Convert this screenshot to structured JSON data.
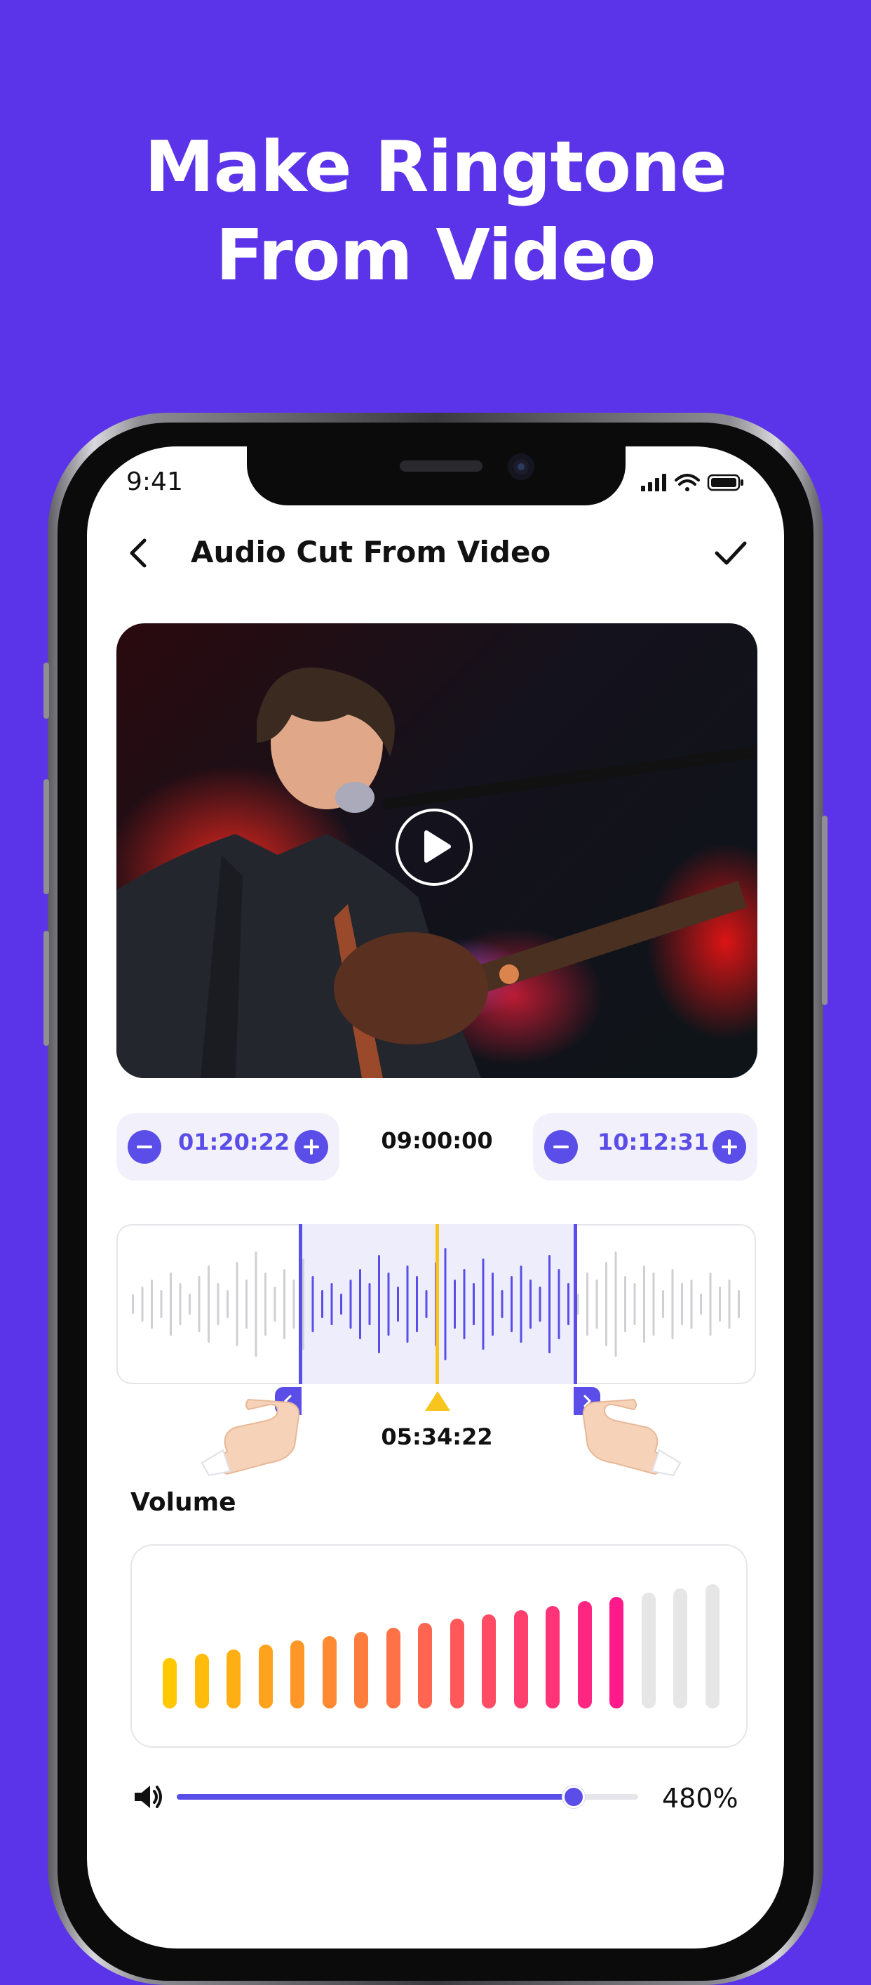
{
  "headline": {
    "line1": "Make Ringtone",
    "line2": "From Video"
  },
  "status_bar": {
    "time": "9:41",
    "icons": [
      "signal-icon",
      "wifi-icon",
      "battery-icon"
    ]
  },
  "nav": {
    "title": "Audio Cut From Video",
    "back_icon": "chevron-left-icon",
    "confirm_icon": "checkmark-icon"
  },
  "video": {
    "play_icon": "play-icon"
  },
  "trim": {
    "start_time": "01:20:22",
    "duration": "09:00:00",
    "end_time": "10:12:31",
    "marker_time": "05:34:22"
  },
  "volume": {
    "label": "Volume",
    "value_text": "480%",
    "level": 0.86,
    "bars_active": 15,
    "bars_total": 18
  },
  "colors": {
    "background": "#5B33E8",
    "accent": "#5B4EE8",
    "playhead": "#F7C51E",
    "volume_gradient_start": "#FFC800",
    "volume_gradient_end": "#FF1A8C",
    "inactive_bar": "#E6E6E6"
  }
}
